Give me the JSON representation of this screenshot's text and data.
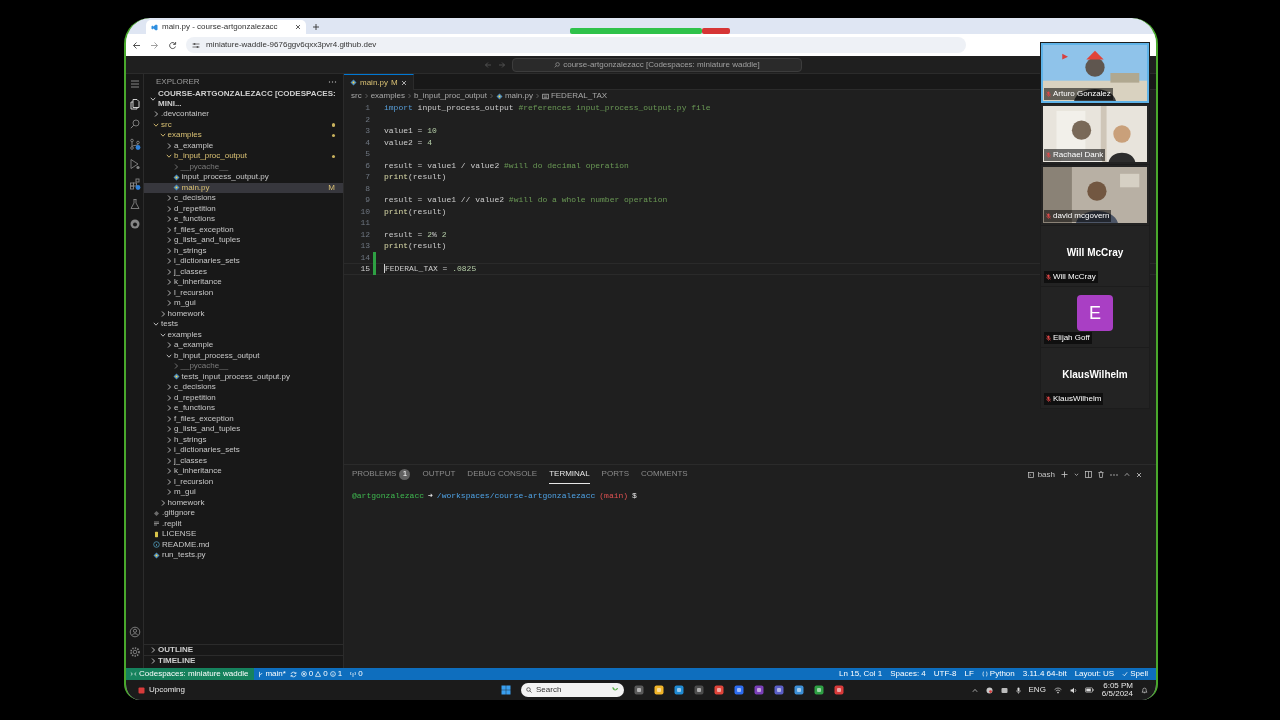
{
  "browser": {
    "tab_title": "main.py - course-artgonzalezacc",
    "url": "miniature-waddle-9676ggv6qxx3pvr4.github.dev"
  },
  "vscode": {
    "command_center": "course-artgonzalezacc [Codespaces: miniature waddle]",
    "activity_bar": [
      {
        "kind": "menu",
        "selected": false
      },
      {
        "kind": "explorer",
        "selected": true
      },
      {
        "kind": "search",
        "selected": false
      },
      {
        "kind": "source-control",
        "selected": false
      },
      {
        "kind": "run-debug",
        "selected": false
      },
      {
        "kind": "extensions",
        "selected": false
      },
      {
        "kind": "testing",
        "selected": false
      },
      {
        "kind": "github",
        "selected": false
      }
    ],
    "activity_bar_bottom": [
      {
        "kind": "account",
        "selected": false
      },
      {
        "kind": "settings",
        "selected": false
      }
    ],
    "sidebar": {
      "title": "EXPLORER",
      "root": "COURSE-ARTGONZALEZACC [CODESPACES: MINI...",
      "tree": [
        {
          "label": ".devcontainer",
          "kind": "folder",
          "expanded": false,
          "selected": false,
          "modified": false
        },
        {
          "label": "src",
          "kind": "folder",
          "expanded": true,
          "selected": false,
          "modified": true,
          "children": [
            {
              "label": "examples",
              "kind": "folder",
              "expanded": true,
              "selected": false,
              "modified": true,
              "children": [
                {
                  "label": "a_example",
                  "kind": "folder",
                  "expanded": false,
                  "selected": false,
                  "modified": false
                },
                {
                  "label": "b_input_proc_output",
                  "kind": "folder",
                  "expanded": true,
                  "selected": false,
                  "modified": true,
                  "children": [
                    {
                      "label": "__pycache__",
                      "kind": "ignored-folder",
                      "expanded": false,
                      "selected": false,
                      "modified": false
                    },
                    {
                      "label": "input_process_output.py",
                      "kind": "python",
                      "selected": false,
                      "modified": false
                    },
                    {
                      "label": "main.py",
                      "kind": "python",
                      "selected": true,
                      "modified": true,
                      "badge": "M"
                    }
                  ]
                },
                {
                  "label": "c_decisions",
                  "kind": "folder",
                  "expanded": false,
                  "selected": false,
                  "modified": false
                },
                {
                  "label": "d_repetition",
                  "kind": "folder",
                  "expanded": false,
                  "selected": false,
                  "modified": false
                },
                {
                  "label": "e_functions",
                  "kind": "folder",
                  "expanded": false,
                  "selected": false,
                  "modified": false
                },
                {
                  "label": "f_files_exception",
                  "kind": "folder",
                  "expanded": false,
                  "selected": false,
                  "modified": false
                },
                {
                  "label": "g_lists_and_tuples",
                  "kind": "folder",
                  "expanded": false,
                  "selected": false,
                  "modified": false
                },
                {
                  "label": "h_strings",
                  "kind": "folder",
                  "expanded": false,
                  "selected": false,
                  "modified": false
                },
                {
                  "label": "i_dictionaries_sets",
                  "kind": "folder",
                  "expanded": false,
                  "selected": false,
                  "modified": false
                },
                {
                  "label": "j_classes",
                  "kind": "folder",
                  "expanded": false,
                  "selected": false,
                  "modified": false
                },
                {
                  "label": "k_inheritance",
                  "kind": "folder",
                  "expanded": false,
                  "selected": false,
                  "modified": false
                },
                {
                  "label": "l_recursion",
                  "kind": "folder",
                  "expanded": false,
                  "selected": false,
                  "modified": false
                },
                {
                  "label": "m_gui",
                  "kind": "folder",
                  "expanded": false,
                  "selected": false,
                  "modified": false
                }
              ]
            },
            {
              "label": "homework",
              "kind": "folder",
              "expanded": false,
              "selected": false,
              "modified": false
            }
          ]
        },
        {
          "label": "tests",
          "kind": "folder",
          "expanded": true,
          "selected": false,
          "modified": false,
          "children": [
            {
              "label": "examples",
              "kind": "folder",
              "expanded": true,
              "selected": false,
              "modified": false,
              "children": [
                {
                  "label": "a_example",
                  "kind": "folder",
                  "expanded": false,
                  "selected": false,
                  "modified": false
                },
                {
                  "label": "b_input_process_output",
                  "kind": "folder",
                  "expanded": true,
                  "selected": false,
                  "modified": false,
                  "children": [
                    {
                      "label": "__pycache__",
                      "kind": "ignored-folder",
                      "expanded": false,
                      "selected": false,
                      "modified": false
                    },
                    {
                      "label": "tests_input_process_output.py",
                      "kind": "python",
                      "selected": false,
                      "modified": false
                    }
                  ]
                },
                {
                  "label": "c_decisions",
                  "kind": "folder",
                  "expanded": false,
                  "selected": false,
                  "modified": false
                },
                {
                  "label": "d_repetition",
                  "kind": "folder",
                  "expanded": false,
                  "selected": false,
                  "modified": false
                },
                {
                  "label": "e_functions",
                  "kind": "folder",
                  "expanded": false,
                  "selected": false,
                  "modified": false
                },
                {
                  "label": "f_files_exception",
                  "kind": "folder",
                  "expanded": false,
                  "selected": false,
                  "modified": false
                },
                {
                  "label": "g_lists_and_tuples",
                  "kind": "folder",
                  "expanded": false,
                  "selected": false,
                  "modified": false
                },
                {
                  "label": "h_strings",
                  "kind": "folder",
                  "expanded": false,
                  "selected": false,
                  "modified": false
                },
                {
                  "label": "i_dictionaries_sets",
                  "kind": "folder",
                  "expanded": false,
                  "selected": false,
                  "modified": false
                },
                {
                  "label": "j_classes",
                  "kind": "folder",
                  "expanded": false,
                  "selected": false,
                  "modified": false
                },
                {
                  "label": "k_inheritance",
                  "kind": "folder",
                  "expanded": false,
                  "selected": false,
                  "modified": false
                },
                {
                  "label": "l_recursion",
                  "kind": "folder",
                  "expanded": false,
                  "selected": false,
                  "modified": false
                },
                {
                  "label": "m_gui",
                  "kind": "folder",
                  "expanded": false,
                  "selected": false,
                  "modified": false
                }
              ]
            },
            {
              "label": "homework",
              "kind": "folder",
              "expanded": false,
              "selected": false,
              "modified": false
            }
          ]
        },
        {
          "label": ".gitignore",
          "kind": "gitignore",
          "selected": false,
          "modified": false
        },
        {
          "label": ".replit",
          "kind": "config",
          "selected": false,
          "modified": false
        },
        {
          "label": "LICENSE",
          "kind": "license",
          "selected": false,
          "modified": false
        },
        {
          "label": "README.md",
          "kind": "markdown",
          "selected": false,
          "modified": false
        },
        {
          "label": "run_tests.py",
          "kind": "python",
          "selected": false,
          "modified": false
        }
      ],
      "sections": [
        {
          "label": "OUTLINE",
          "expanded": false
        },
        {
          "label": "TIMELINE",
          "expanded": false
        }
      ]
    },
    "editor": {
      "tabs": [
        {
          "label": "main.py",
          "badge": "M",
          "selected": true
        }
      ],
      "breadcrumb": [
        {
          "text": "src",
          "kind": "folder"
        },
        {
          "text": "examples",
          "kind": "folder"
        },
        {
          "text": "b_input_proc_output",
          "kind": "folder"
        },
        {
          "text": "main.py",
          "kind": "python"
        },
        {
          "text": "FEDERAL_TAX",
          "kind": "constant"
        }
      ],
      "lines": [
        {
          "number": "1",
          "tokens": [
            {
              "text": "import",
              "kind": "keyword"
            },
            {
              "text": " input_process_output ",
              "kind": "plain"
            },
            {
              "text": "#references input_process_output.py file",
              "kind": "comment"
            }
          ]
        },
        {
          "number": "2"
        },
        {
          "number": "3",
          "tokens": [
            {
              "text": "value1 = ",
              "kind": "plain"
            },
            {
              "text": "10",
              "kind": "number"
            }
          ]
        },
        {
          "number": "4",
          "tokens": [
            {
              "text": "value2 = ",
              "kind": "plain"
            },
            {
              "text": "4",
              "kind": "number"
            }
          ]
        },
        {
          "number": "5"
        },
        {
          "number": "6",
          "tokens": [
            {
              "text": "result = value1 / value2 ",
              "kind": "plain"
            },
            {
              "text": "#will do decimal operation",
              "kind": "comment"
            }
          ]
        },
        {
          "number": "7",
          "tokens": [
            {
              "text": "print",
              "kind": "function"
            },
            {
              "text": "(result)",
              "kind": "plain"
            }
          ]
        },
        {
          "number": "8"
        },
        {
          "number": "9",
          "tokens": [
            {
              "text": "result = value1 // value2 ",
              "kind": "plain"
            },
            {
              "text": "#will do a whole number operation",
              "kind": "comment"
            }
          ]
        },
        {
          "number": "10",
          "tokens": [
            {
              "text": "print",
              "kind": "function"
            },
            {
              "text": "(result)",
              "kind": "plain"
            }
          ]
        },
        {
          "number": "11"
        },
        {
          "number": "12",
          "tokens": [
            {
              "text": "result = ",
              "kind": "plain"
            },
            {
              "text": "2",
              "kind": "number"
            },
            {
              "text": "% ",
              "kind": "plain"
            },
            {
              "text": "2",
              "kind": "number"
            }
          ]
        },
        {
          "number": "13",
          "tokens": [
            {
              "text": "print",
              "kind": "function"
            },
            {
              "text": "(result)",
              "kind": "plain"
            }
          ]
        },
        {
          "number": "14",
          "added": true
        },
        {
          "number": "15",
          "added": true,
          "current": true,
          "tokens": [
            {
              "text": "FEDERAL_TAX = ",
              "kind": "plain"
            },
            {
              "text": ".0825",
              "kind": "number"
            }
          ]
        }
      ]
    },
    "panel": {
      "tabs": [
        {
          "label": "PROBLEMS",
          "badge": "1",
          "selected": false
        },
        {
          "label": "OUTPUT",
          "selected": false
        },
        {
          "label": "DEBUG CONSOLE",
          "selected": false
        },
        {
          "label": "TERMINAL",
          "selected": true
        },
        {
          "label": "PORTS",
          "selected": false
        },
        {
          "label": "COMMENTS",
          "selected": false
        }
      ],
      "shell": "bash",
      "terminal": [
        {
          "text": "@artgonzalezacc",
          "kind": "user"
        },
        {
          "text": "➜",
          "kind": "arrow"
        },
        {
          "text": "/workspaces/course-artgonzalezacc",
          "kind": "path"
        },
        {
          "text": "(main)",
          "kind": "branch"
        },
        {
          "text": "$",
          "kind": "prompt"
        }
      ]
    },
    "status_bar": {
      "left": [
        {
          "kind": "remote",
          "text": "Codespaces: miniature waddle"
        },
        {
          "kind": "branch",
          "text": "main*"
        },
        {
          "kind": "sync"
        },
        {
          "kind": "problems",
          "errors": "0",
          "warnings": "0",
          "info": "1"
        },
        {
          "kind": "ports",
          "text": "0"
        }
      ],
      "right": [
        {
          "kind": "text",
          "text": "Ln 15, Col 1"
        },
        {
          "kind": "text",
          "text": "Spaces: 4"
        },
        {
          "kind": "text",
          "text": "UTF-8"
        },
        {
          "kind": "text",
          "text": "LF"
        },
        {
          "kind": "language",
          "text": "Python"
        },
        {
          "kind": "text",
          "text": "3.11.4 64-bit"
        },
        {
          "kind": "text",
          "text": "Layout: US"
        },
        {
          "kind": "check",
          "text": "Spell"
        }
      ]
    }
  },
  "participants": [
    {
      "name": "Arturo Gonzalez",
      "kind": "camera",
      "speaking": true,
      "muted": true
    },
    {
      "name": "Rachael Dank",
      "kind": "camera",
      "speaking": false,
      "muted": true
    },
    {
      "name": "david mcgovern",
      "kind": "camera",
      "speaking": false,
      "muted": true
    },
    {
      "name": "Will McCray",
      "kind": "name",
      "display": "Will McCray",
      "speaking": false,
      "muted": true
    },
    {
      "name": "Elijah Goff",
      "kind": "avatar",
      "initial": "E",
      "color": "#a93fc4",
      "speaking": false,
      "muted": true
    },
    {
      "name": "KlausWilhelm",
      "kind": "name",
      "display": "KlausWilhelm",
      "speaking": false,
      "muted": true
    }
  ],
  "taskbar": {
    "notification": "Upcoming",
    "search_placeholder": "Search",
    "apps": [
      {
        "color": "#5a5a5a"
      },
      {
        "color": "#f0b429"
      },
      {
        "color": "#1f8ad2"
      },
      {
        "color": "#4d4d4d"
      },
      {
        "color": "#e0443a"
      },
      {
        "color": "#2d6cf0"
      },
      {
        "color": "#7b3fb8"
      },
      {
        "color": "#5b5fc7"
      },
      {
        "color": "#3d8fd6"
      },
      {
        "color": "#2ea043"
      },
      {
        "color": "#d93a3a"
      }
    ],
    "language": "ENG",
    "time": "6:05 PM",
    "date": "6/5/2024"
  }
}
